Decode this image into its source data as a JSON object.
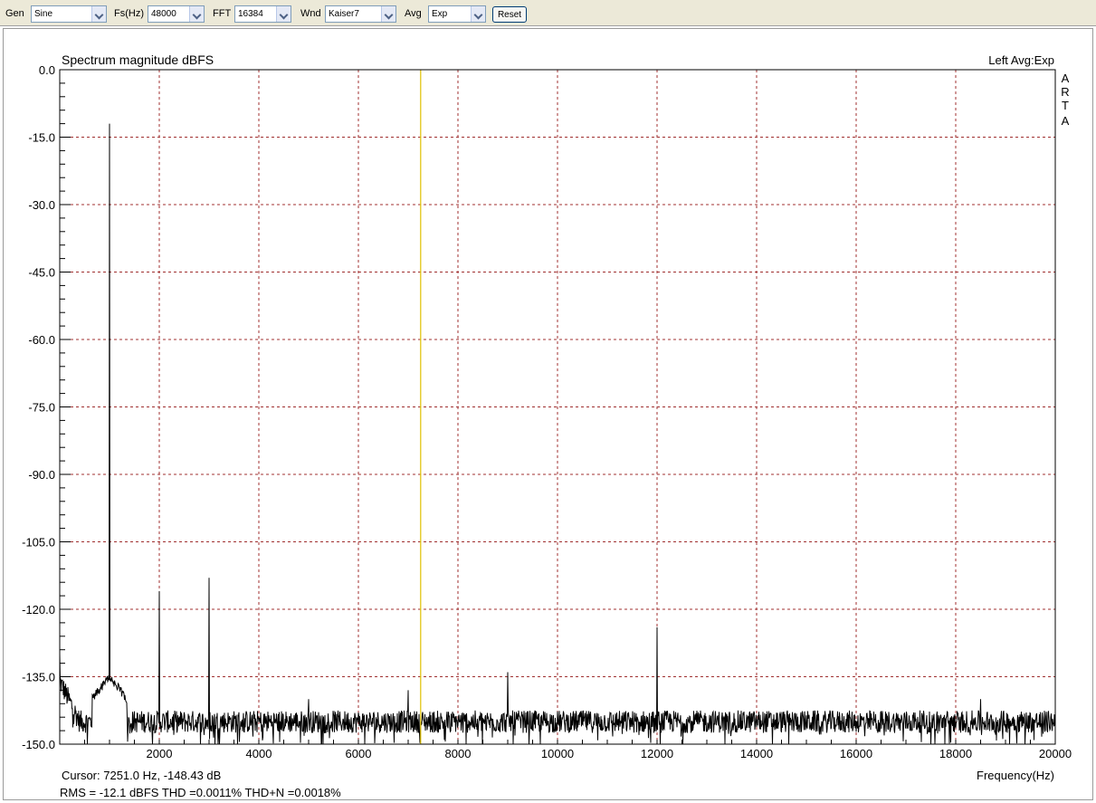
{
  "toolbar": {
    "gen_label": "Gen",
    "gen_value": "Sine",
    "fs_label": "Fs(Hz)",
    "fs_value": "48000",
    "fft_label": "FFT",
    "fft_value": "16384",
    "wnd_label": "Wnd",
    "wnd_value": "Kaiser7",
    "avg_label": "Avg",
    "avg_value": "Exp",
    "reset_label": "Reset"
  },
  "chart": {
    "side_label": [
      "A",
      "R",
      "T",
      "A"
    ],
    "cursor_text": "Cursor:  7251.0 Hz, -148.43 dB",
    "stats_text": "RMS =  -12.1 dBFS   THD =0.0011%   THD+N =0.0018%",
    "cursor_color": "#e0c000",
    "stats_color": "#c00000",
    "grid_color": "#a03030"
  },
  "chart_data": {
    "type": "line",
    "title": "Spectrum magnitude dBFS",
    "legend": "Left  Avg:Exp",
    "xlabel": "Frequency(Hz)",
    "ylabel": "",
    "xlim": [
      0,
      20000
    ],
    "ylim": [
      -150,
      0
    ],
    "x_ticks": [
      2000,
      4000,
      6000,
      8000,
      10000,
      12000,
      14000,
      16000,
      18000,
      20000
    ],
    "y_ticks": [
      "0.0",
      "-15.0",
      "-30.0",
      "-45.0",
      "-60.0",
      "-75.0",
      "-90.0",
      "-105.0",
      "-120.0",
      "-135.0",
      "-150.0"
    ],
    "grid": true,
    "cursor_x": 7251,
    "noise_floor_db": -145,
    "peaks": [
      {
        "x": 0,
        "y": -130
      },
      {
        "x": 1000,
        "y": -12
      },
      {
        "x": 2000,
        "y": -116
      },
      {
        "x": 3000,
        "y": -113
      },
      {
        "x": 5000,
        "y": -140
      },
      {
        "x": 7000,
        "y": -138
      },
      {
        "x": 9000,
        "y": -134
      },
      {
        "x": 12000,
        "y": -124
      },
      {
        "x": 18500,
        "y": -140
      }
    ]
  }
}
